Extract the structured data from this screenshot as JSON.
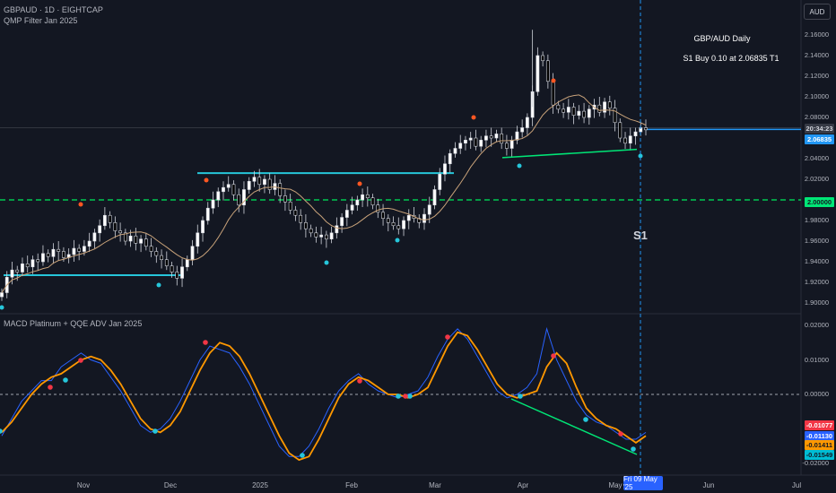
{
  "header": {
    "symbol_line": "GBPAUD · 1D · EIGHTCAP",
    "indicator1": "QMP Filter Jan 2025",
    "indicator2": "MACD Platinum + QQE ADV Jan 2025"
  },
  "currency_button": "AUD",
  "annotation": {
    "title": "GBP/AUD Daily",
    "trade": "S1 Buy 0.10 at 2.06835 T1",
    "marker": "S1"
  },
  "price_axis": {
    "ticks": [
      "2.16000",
      "2.14000",
      "2.12000",
      "2.10000",
      "2.08000",
      "2.04000",
      "2.02000",
      "1.98000",
      "1.96000",
      "1.94000",
      "1.92000",
      "1.90000"
    ],
    "countdown": "20:34:23",
    "last_price": "2.06835",
    "level_label": "2.00000"
  },
  "macd_axis": {
    "ticks": [
      "0.02000",
      "0.01000",
      "0.00000",
      "-0.02000"
    ],
    "labels": [
      "-0.01077",
      "-0.01130",
      "-0.01411",
      "-0.01549"
    ]
  },
  "time_axis": {
    "ticks": [
      "Nov",
      "Dec",
      "2025",
      "Feb",
      "Mar",
      "Apr",
      "May",
      "Jun",
      "Jul"
    ],
    "cursor": "Fri 09 May '25"
  },
  "colors": {
    "background": "#131722",
    "up_candle": "#ffffff",
    "down_candle": "#000000",
    "support_line": "#26c6da",
    "trend_line": "#00e676",
    "level_line": "#00c853",
    "moving_average": "#c8a27a",
    "last_price_line": "#2196f3",
    "macd_line": "#ff9800",
    "signal_line": "#2962ff",
    "buy_dot": "#26c6da",
    "sell_dot": "#ff5722",
    "macd_dot_red": "#f23645"
  },
  "chart_data": [
    {
      "type": "candlestick",
      "symbol": "GBPAUD",
      "timeframe": "1D",
      "ylim": [
        1.89,
        2.17
      ],
      "ohlc_close": [
        1.91,
        1.925,
        1.932,
        1.93,
        1.938,
        1.935,
        1.942,
        1.94,
        1.948,
        1.945,
        1.952,
        1.95,
        1.944,
        1.947,
        1.953,
        1.95,
        1.955,
        1.96,
        1.968,
        1.975,
        1.985,
        1.978,
        1.97,
        1.968,
        1.96,
        1.965,
        1.958,
        1.962,
        1.955,
        1.95,
        1.946,
        1.942,
        1.936,
        1.93,
        1.924,
        1.935,
        1.942,
        1.955,
        1.968,
        1.98,
        1.992,
        2.0,
        2.008,
        2.012,
        2.015,
        2.005,
        1.995,
        2.01,
        2.018,
        2.022,
        2.015,
        2.02,
        2.01,
        2.016,
        2.004,
        1.998,
        1.99,
        1.985,
        1.978,
        1.972,
        1.968,
        1.964,
        1.966,
        1.962,
        1.968,
        1.975,
        1.983,
        1.99,
        1.995,
        2.0,
        2.005,
        2.002,
        1.995,
        1.988,
        1.982,
        1.978,
        1.975,
        1.972,
        1.98,
        1.985,
        1.982,
        1.978,
        1.986,
        1.995,
        2.01,
        2.025,
        2.035,
        2.045,
        2.05,
        2.055,
        2.058,
        2.06,
        2.052,
        2.058,
        2.062,
        2.06,
        2.064,
        2.055,
        2.05,
        2.058,
        2.066,
        2.07,
        2.08,
        2.105,
        2.14,
        2.135,
        2.115,
        2.092,
        2.088,
        2.085,
        2.09,
        2.082,
        2.086,
        2.08,
        2.088,
        2.092,
        2.085,
        2.095,
        2.089,
        2.075,
        2.06,
        2.055,
        2.062,
        2.066,
        2.07,
        2.068
      ],
      "support_lines": [
        [
          1.927
        ],
        [
          2.026
        ]
      ],
      "horizontal_level": 2.0
    },
    {
      "type": "line",
      "title": "MACD Platinum + QQE ADV Jan 2025",
      "ylim": [
        -0.022,
        0.023
      ],
      "series": [
        {
          "values": [
            -0.011,
            -0.008,
            -0.004,
            0.0,
            0.003,
            0.005,
            0.006,
            0.008,
            0.01,
            0.011,
            0.01,
            0.007,
            0.003,
            -0.002,
            -0.007,
            -0.01,
            -0.011,
            -0.009,
            -0.005,
            0.001,
            0.007,
            0.012,
            0.015,
            0.014,
            0.011,
            0.006,
            0.0,
            -0.006,
            -0.012,
            -0.017,
            -0.019,
            -0.018,
            -0.013,
            -0.007,
            -0.001,
            0.003,
            0.005,
            0.004,
            0.002,
            0.0,
            0.0,
            -0.001,
            0.0,
            0.002,
            0.008,
            0.014,
            0.018,
            0.017,
            0.013,
            0.008,
            0.003,
            0.0,
            -0.001,
            0.0,
            0.001,
            0.008,
            0.012,
            0.009,
            0.002,
            -0.004,
            -0.007,
            -0.009,
            -0.01,
            -0.012,
            -0.014,
            -0.012
          ]
        },
        {
          "values": [
            -0.012,
            -0.007,
            -0.002,
            0.001,
            0.004,
            0.004,
            0.008,
            0.01,
            0.012,
            0.01,
            0.009,
            0.005,
            0.001,
            -0.004,
            -0.009,
            -0.011,
            -0.01,
            -0.007,
            -0.002,
            0.004,
            0.01,
            0.014,
            0.013,
            0.012,
            0.008,
            0.003,
            -0.003,
            -0.009,
            -0.015,
            -0.018,
            -0.018,
            -0.015,
            -0.01,
            -0.004,
            0.001,
            0.004,
            0.006,
            0.003,
            0.001,
            0.0,
            -0.001,
            0.0,
            0.001,
            0.005,
            0.011,
            0.016,
            0.019,
            0.016,
            0.011,
            0.006,
            0.001,
            -0.001,
            0.0,
            0.002,
            0.006,
            0.019,
            0.01,
            0.004,
            -0.002,
            -0.006,
            -0.008,
            -0.009,
            -0.011,
            -0.013,
            -0.013,
            -0.011
          ]
        }
      ]
    }
  ]
}
